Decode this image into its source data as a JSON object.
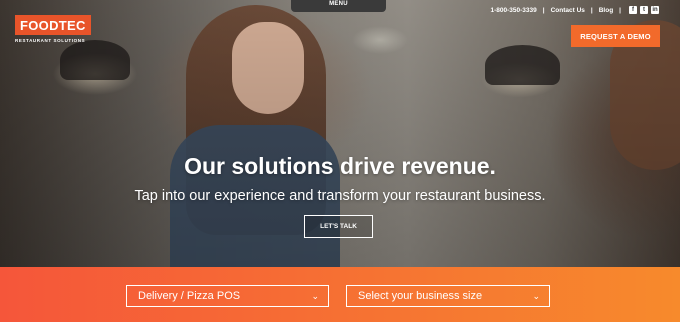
{
  "menu_tab": "MENU",
  "logo": {
    "name": "FOODTEC",
    "tagline": "RESTAURANT SOLUTIONS"
  },
  "topbar": {
    "phone": "1-800-350-3339",
    "contact": "Contact Us",
    "blog": "Blog",
    "social": [
      {
        "icon": "facebook-icon",
        "glyph": "f"
      },
      {
        "icon": "twitter-icon",
        "glyph": "t"
      },
      {
        "icon": "linkedin-icon",
        "glyph": "in"
      }
    ]
  },
  "demo_button": "REQUEST A DEMO",
  "hero": {
    "headline": "Our solutions drive revenue.",
    "subline": "Tap into our experience and transform your restaurant business.",
    "cta": "LET'S TALK"
  },
  "filters": {
    "product": "Delivery / Pizza POS",
    "size": "Select your business size"
  },
  "colors": {
    "accent": "#f26a2b",
    "band_start": "#f5563a",
    "band_end": "#f78a2c"
  }
}
